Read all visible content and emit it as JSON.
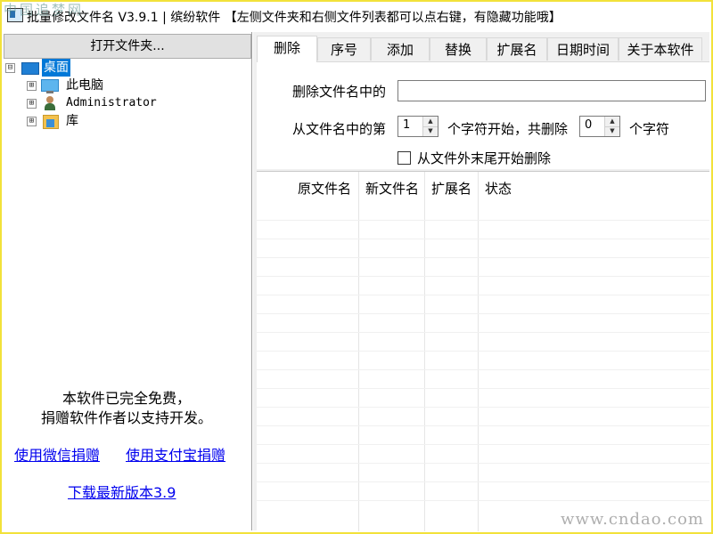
{
  "window": {
    "title": "批量修改文件名 V3.9.1 | 缤纷软件 【左侧文件夹和右侧文件列表都可以点右键，有隐藏功能哦】",
    "watermark_top": "中国追梦网",
    "watermark_bottom": "www.cndao.com"
  },
  "left_panel": {
    "open_folder_button": "打开文件夹...",
    "tree": [
      {
        "label": "桌面",
        "icon": "desktop-icon",
        "expander": "⊟",
        "selected": true
      },
      {
        "label": "此电脑",
        "icon": "computer-icon",
        "expander": "⊞"
      },
      {
        "label": "Administrator",
        "icon": "user-icon",
        "expander": "⊞"
      },
      {
        "label": "库",
        "icon": "library-icon",
        "expander": "⊞"
      }
    ],
    "promo_line1": "本软件已完全免费，",
    "promo_line2": "捐赠软件作者以支持开发。",
    "link_wechat": "使用微信捐赠",
    "link_alipay": "使用支付宝捐赠",
    "link_download": "下载最新版本3.9"
  },
  "tabs": [
    "删除",
    "序号",
    "添加",
    "替换",
    "扩展名",
    "日期时间",
    "关于本软件"
  ],
  "delete_panel": {
    "label_delete_name": "删除文件名中的",
    "delete_name_value": "",
    "label_from_pos": "从文件名中的第",
    "start_value": "1",
    "label_start_delete": "个字符开始，共删除",
    "count_value": "0",
    "label_chars": "个字符",
    "checkbox_label": "从文件外末尾开始删除",
    "checkbox_checked": false
  },
  "file_list": {
    "columns": [
      "原文件名",
      "新文件名",
      "扩展名",
      "状态"
    ],
    "rows": []
  },
  "colors": {
    "selection": "#0078d7",
    "frame_border": "#f2e23a",
    "link": "#0000ee"
  }
}
